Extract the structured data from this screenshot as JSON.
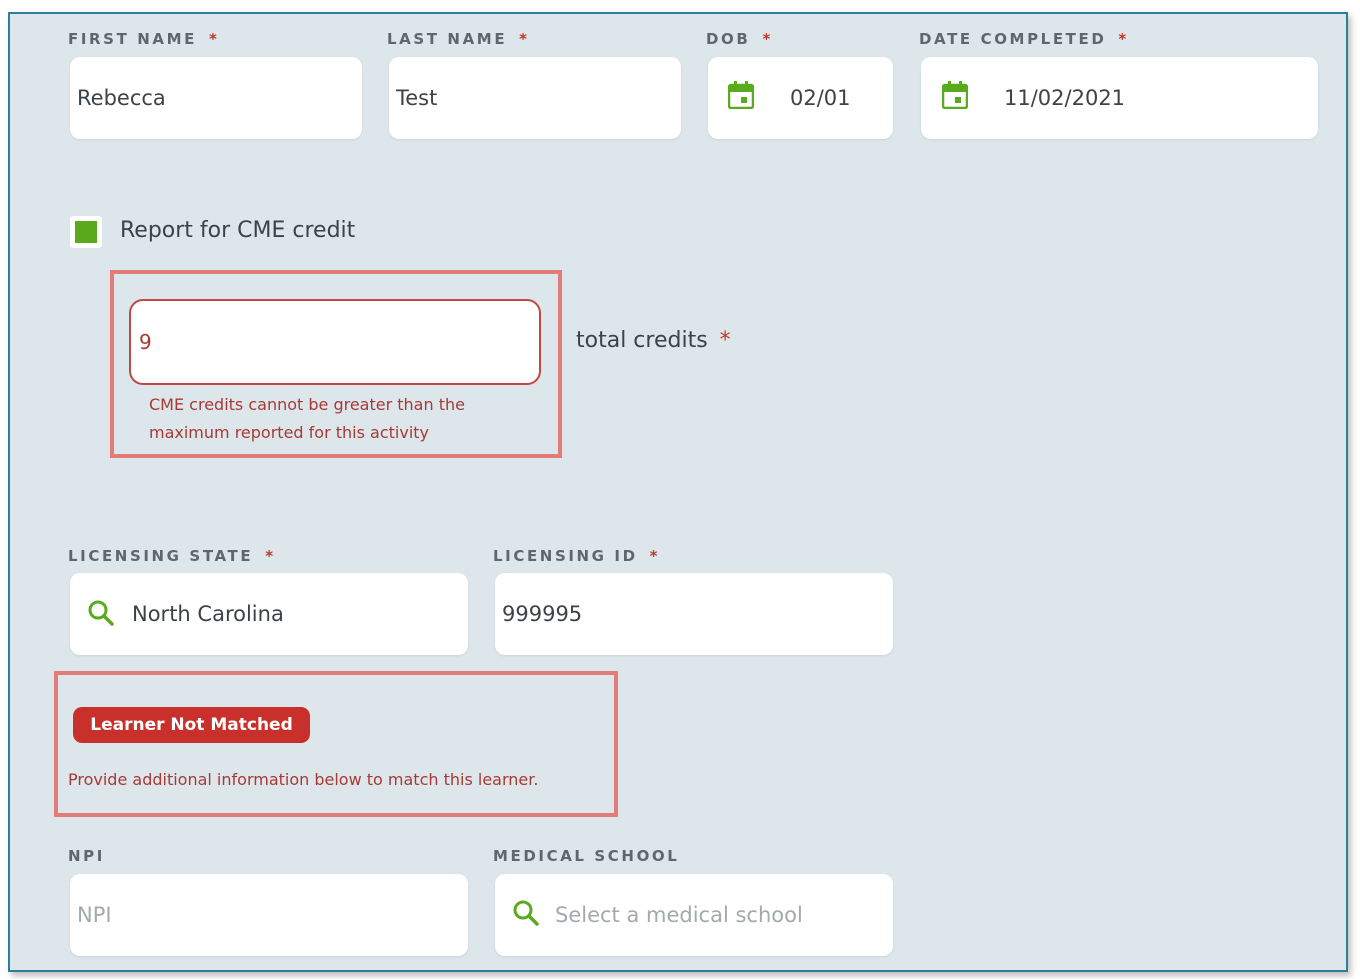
{
  "colors": {
    "panel_bg": "#dde6ea",
    "accent_green": "#5aaa1e",
    "error_red": "#c9302c",
    "highlight_border": "#e27c76"
  },
  "required_marker": "*",
  "first_name": {
    "label": "FIRST NAME",
    "value": "Rebecca"
  },
  "last_name": {
    "label": "LAST NAME",
    "value": "Test"
  },
  "dob": {
    "label": "DOB",
    "value": "02/01",
    "icon": "calendar-icon"
  },
  "date_completed": {
    "label": "DATE COMPLETED",
    "value": "11/02/2021",
    "icon": "calendar-icon"
  },
  "cme": {
    "checkbox_label": "Report for CME credit",
    "checked": true,
    "credits_value": "9",
    "credits_label": "total credits",
    "error_line1": "CME credits cannot be greater than the",
    "error_line2": "maximum reported for this activity"
  },
  "licensing_state": {
    "label": "LICENSING STATE",
    "value": "North Carolina",
    "icon": "search-icon"
  },
  "licensing_id": {
    "label": "LICENSING ID",
    "value": "999995"
  },
  "match_status": {
    "badge": "Learner Not Matched",
    "message": "Provide additional information below to match this learner."
  },
  "npi": {
    "label": "NPI",
    "placeholder": "NPI"
  },
  "medical_school": {
    "label": "MEDICAL SCHOOL",
    "placeholder": "Select a medical school",
    "icon": "search-icon"
  }
}
